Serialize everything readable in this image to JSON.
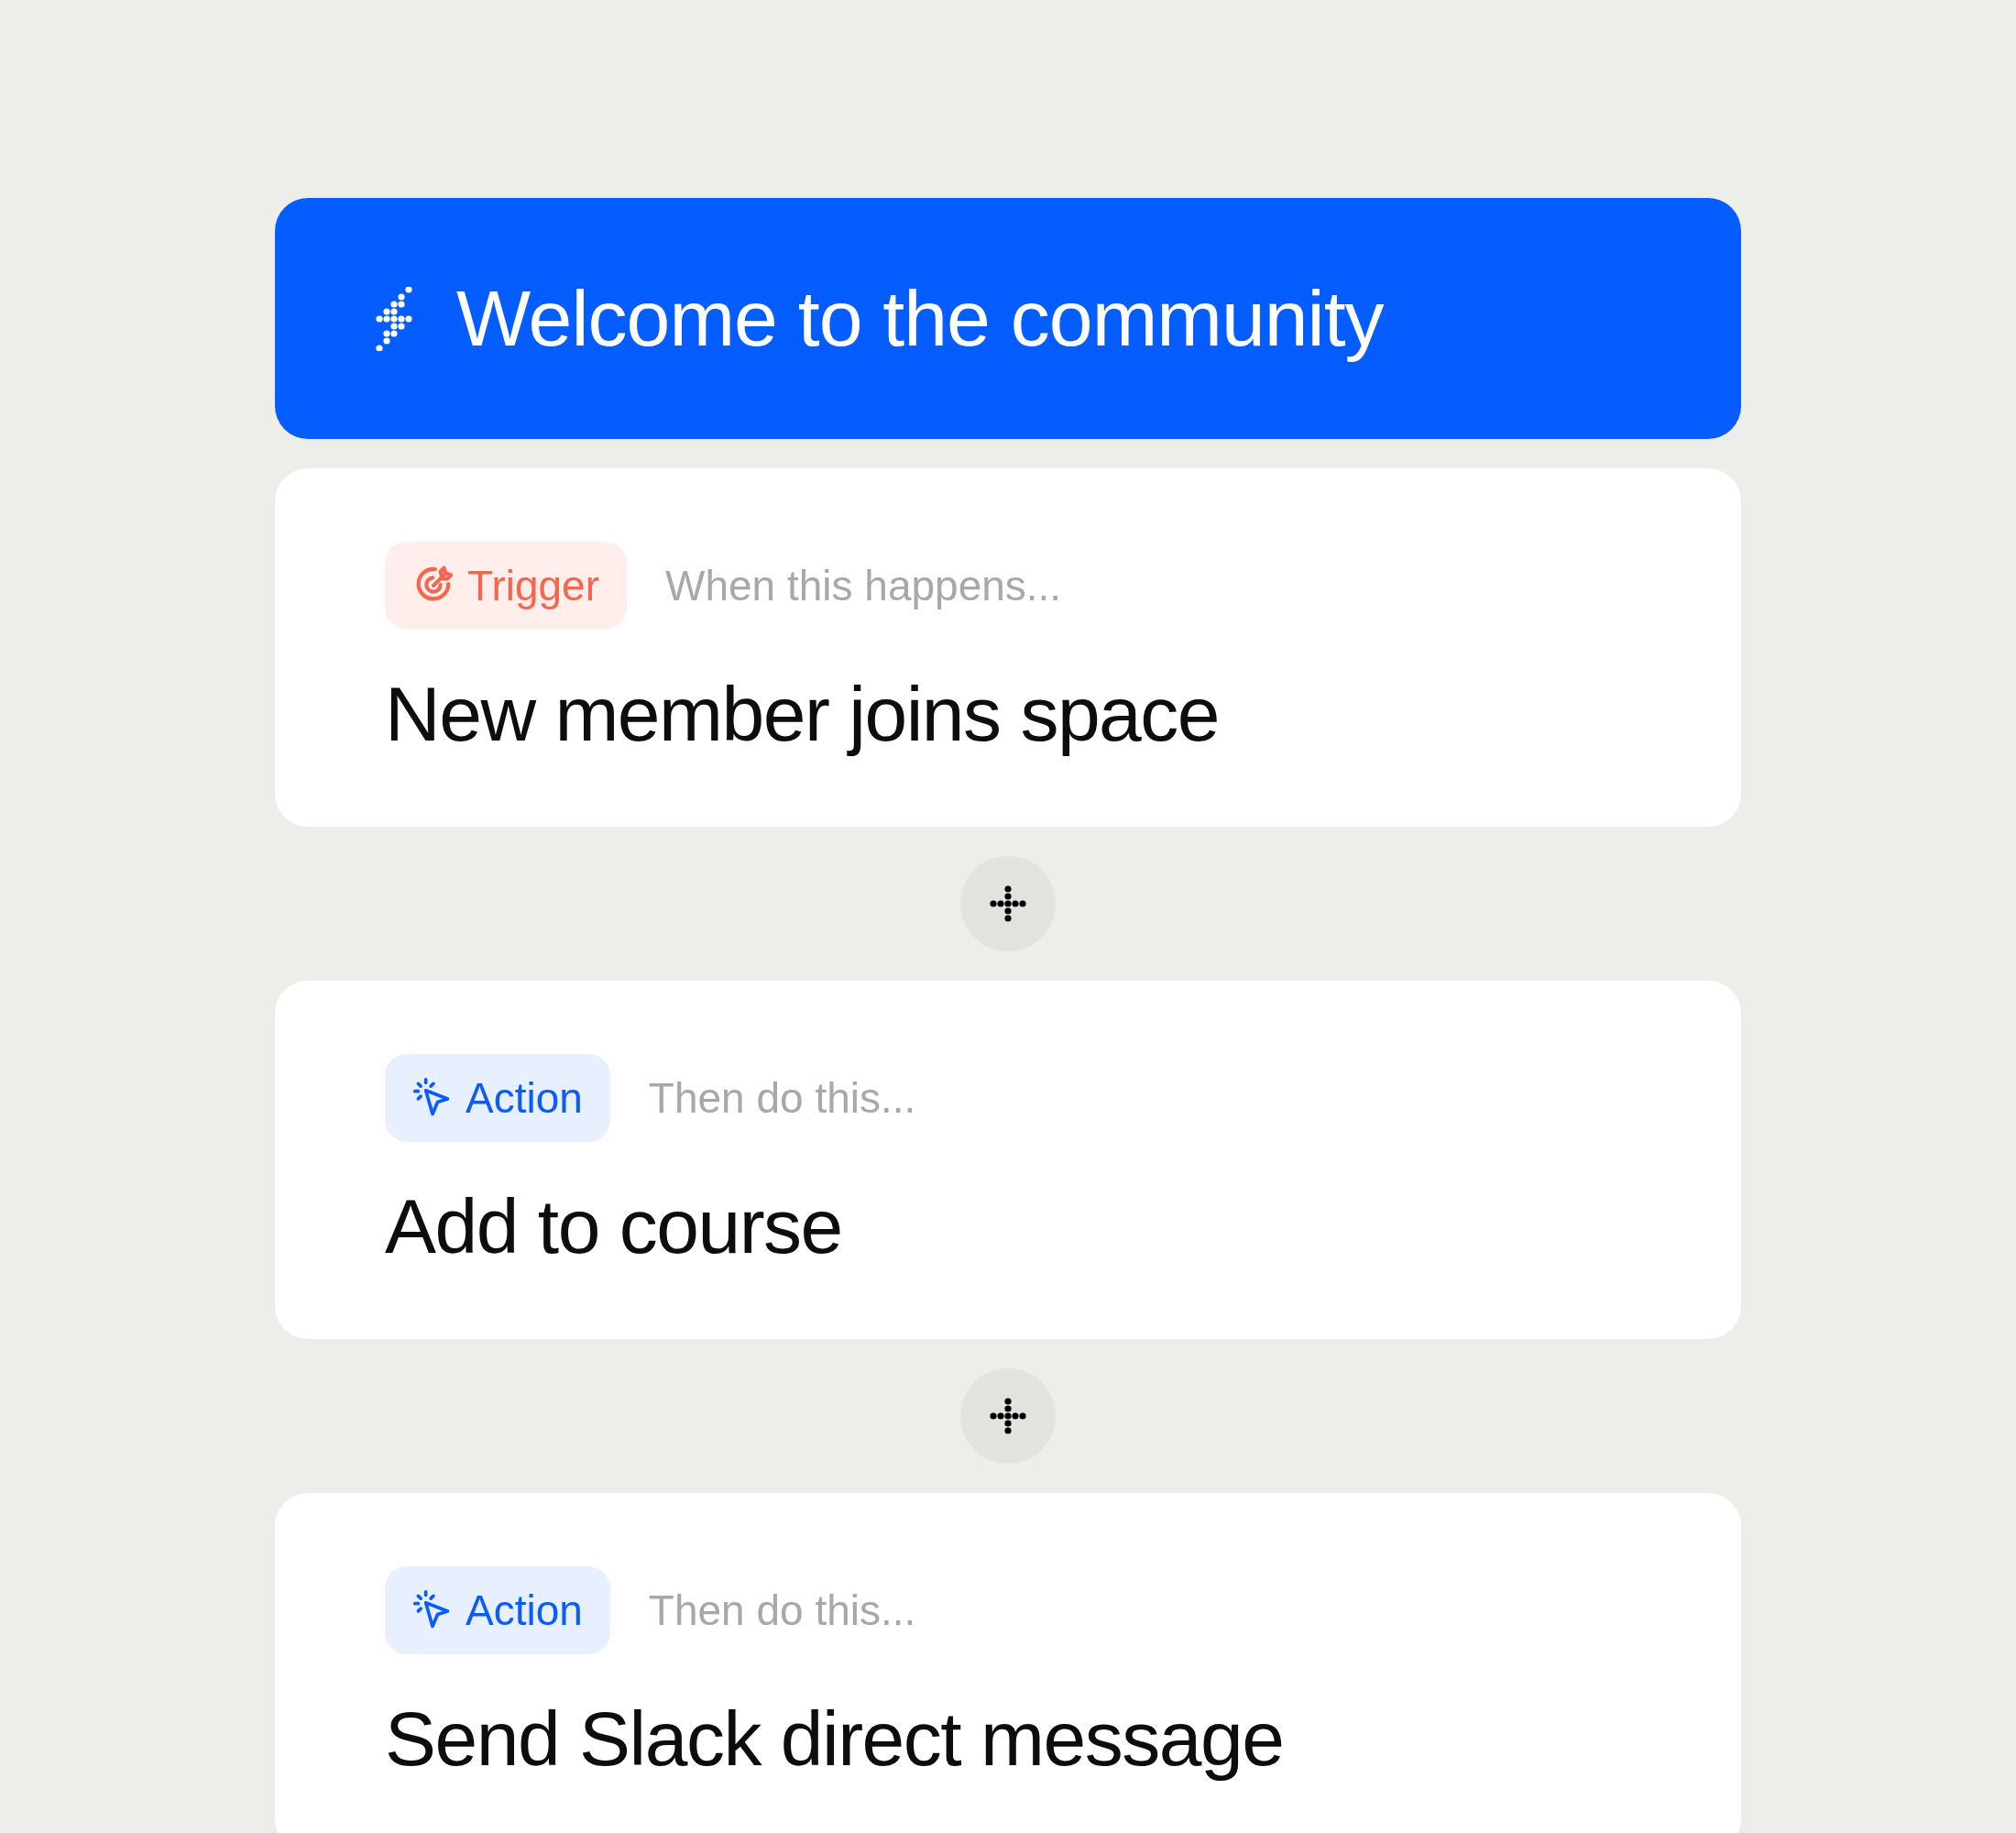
{
  "workflow": {
    "title": "Welcome to the community"
  },
  "steps": [
    {
      "kind": "trigger",
      "badge": "Trigger",
      "hint": "When this happens...",
      "title": "New member joins space"
    },
    {
      "kind": "action",
      "badge": "Action",
      "hint": "Then do this...",
      "title": "Add to course"
    },
    {
      "kind": "action",
      "badge": "Action",
      "hint": "Then do this...",
      "title": "Send Slack direct message"
    }
  ]
}
